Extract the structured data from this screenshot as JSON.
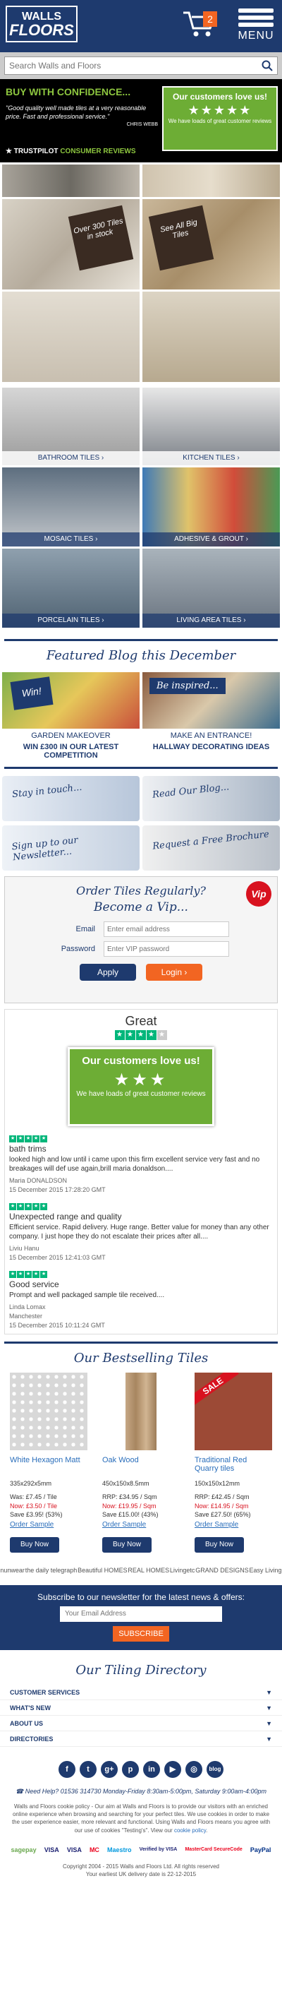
{
  "header": {
    "logo_line1": "WALLS",
    "logo_line2": "FLOORS",
    "cart_count": "2",
    "menu_label": "MENU",
    "search_placeholder": "Search Walls and Floors"
  },
  "trust": {
    "heading": "BUY WITH CONFIDENCE...",
    "quote": "\"Good quality well made tiles at a very reasonable price. Fast and professional service.\"",
    "author": "CHRIS WEBB",
    "tp_brand": "TRUSTPILOT",
    "tp_label": "CONSUMER REVIEWS",
    "box_title": "Our customers love us!",
    "box_stars": "★★★★★",
    "box_sub": "We have loads of great customer reviews"
  },
  "hero": {
    "tag1": "Over 300 Tiles in stock",
    "tag2": "See All Big Tiles"
  },
  "categories": [
    {
      "label": "BATHROOM TILES  ›"
    },
    {
      "label": "KITCHEN TILES  ›"
    },
    {
      "label": "MOSAIC TILES  ›"
    },
    {
      "label": "ADHESIVE & GROUT  ›"
    },
    {
      "label": "PORCELAIN TILES  ›"
    },
    {
      "label": "LIVING AREA TILES  ›"
    }
  ],
  "blog": {
    "title": "Featured Blog this December",
    "items": [
      {
        "image_text": "Win!",
        "caption1": "GARDEN MAKEOVER",
        "caption2": "WIN £300 IN OUR LATEST COMPETITION"
      },
      {
        "image_text": "Be inspired...",
        "caption1": "MAKE AN ENTRANCE!",
        "caption2": "HALLWAY DECORATING IDEAS"
      }
    ]
  },
  "promos": [
    {
      "label": "Stay in touch..."
    },
    {
      "label": "Read Our Blog..."
    },
    {
      "label": "Sign up to our Newsletter..."
    },
    {
      "label": "Request a Free Brochure"
    }
  ],
  "vip": {
    "title1": "Order Tiles Regularly?",
    "title2": "Become a Vip...",
    "badge": "Vip",
    "email_label": "Email",
    "email_placeholder": "Enter email address",
    "password_label": "Password",
    "password_placeholder": "Enter VIP password",
    "apply": "Apply",
    "login": "Login  ›"
  },
  "reviews": {
    "rating_word": "Great",
    "box_title": "Our customers love us!",
    "box_stars": "★★★",
    "box_sub": "We have loads of great customer reviews",
    "list": [
      {
        "title": "bath trims",
        "body": "looked high and low until i came upon this firm excellent service very fast and no breakages will def use again,brill maria donaldson....",
        "name": "Maria DONALDSON",
        "date": "15 December 2015 17:28:20 GMT"
      },
      {
        "title": "Unexpected range and quality",
        "body": "Efficient service. Rapid delivery. Huge range. Better value for money than any other company. I just hope they do not escalate their prices after all....",
        "name": "Liviu Hanu",
        "date": "15 December 2015 12:41:03 GMT"
      },
      {
        "title": "Good service",
        "body": "Prompt and well packaged sample tile received....",
        "name": "Linda Lomax",
        "location": "Manchester",
        "date": "15 December 2015 10:11:24 GMT"
      }
    ]
  },
  "bestselling": {
    "title": "Our Bestselling Tiles",
    "products": [
      {
        "name": "White Hexagon Matt",
        "size": "335x292x5mm",
        "was": "Was: £7.45 / Tile",
        "now": "Now: £3.50 / Tile",
        "save": "Save £3.95! (53%)",
        "sample": "Order Sample",
        "buy": "Buy Now"
      },
      {
        "name": "Oak Wood",
        "size": "450x150x8.5mm",
        "was": "RRP: £34.95 / Sqm",
        "now": "Now: £19.95 / Sqm",
        "save": "Save £15.00! (43%)",
        "sample": "Order Sample",
        "buy": "Buy Now"
      },
      {
        "name": "Traditional Red Quarry tiles",
        "size": "150x150x12mm",
        "was": "RRP: £42.45 / Sqm",
        "now": "Now: £14.95 / Sqm",
        "save": "Save £27.50! (65%)",
        "sample": "Order Sample",
        "buy": "Buy Now",
        "badge": "SALE"
      }
    ]
  },
  "press": [
    "nunwear",
    "the daily telegraph",
    "Beautiful HOMES",
    "REAL HOMES",
    "Livingetc",
    "GRAND DESIGNS",
    "Easy Living"
  ],
  "newsletter": {
    "title": "Subscribe to our newsletter for the latest news & offers:",
    "placeholder": "Your Email Address",
    "button": "SUBSCRIBE"
  },
  "directory": {
    "title": "Our Tiling Directory",
    "items": [
      {
        "label": "CUSTOMER SERVICES"
      },
      {
        "label": "WHAT'S NEW"
      },
      {
        "label": "ABOUT US"
      },
      {
        "label": "DIRECTORIES"
      }
    ]
  },
  "social": [
    "f",
    "t",
    "g+",
    "p",
    "in",
    "▶",
    "◎",
    "blog"
  ],
  "footer": {
    "help": "Need Help?  01536 314730  Monday-Friday 8:30am-5:00pm, Saturday 9:00am-4:00pm",
    "cookie": "Walls and Floors cookie policy - Our aim at Walls and Floors is to provide our visitors with an enriched online experience when browsing and searching for your perfect tiles. We use cookies in order to make the user experience easier, more relevant and functional. Using Walls and Floors means you agree with our use of cookies \"Testing's\". View our",
    "cookie_link": "cookie policy",
    "payments": [
      "sagepay",
      "VISA",
      "VISA",
      "MC",
      "Maestro",
      "Verified by VISA",
      "MasterCard SecureCode",
      "PayPal"
    ],
    "copyright": "Copyright 2004 - 2015 Walls and Floors Ltd. All rights reserved",
    "delivery": "Your earliest UK delivery date is 22-12-2015"
  },
  "colors": {
    "navy": "#1e3a6e",
    "orange": "#f26522",
    "green": "#6dad35",
    "tp_green": "#00b67a"
  }
}
